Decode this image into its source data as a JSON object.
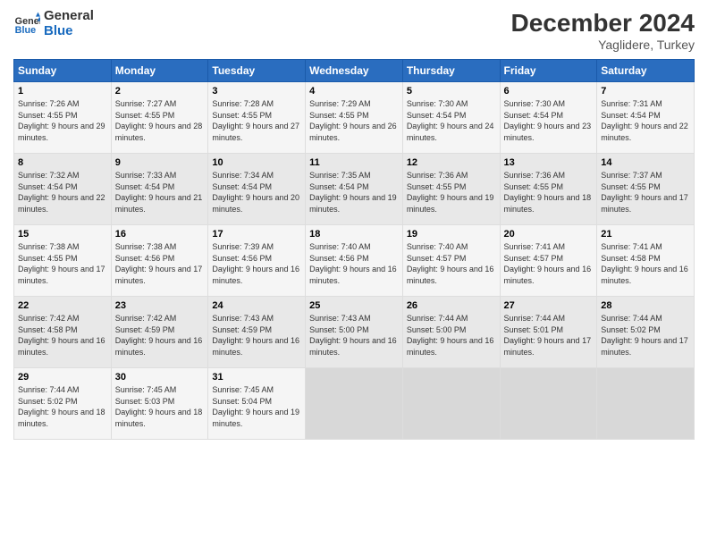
{
  "header": {
    "logo_line1": "General",
    "logo_line2": "Blue",
    "month": "December 2024",
    "location": "Yaglidere, Turkey"
  },
  "weekdays": [
    "Sunday",
    "Monday",
    "Tuesday",
    "Wednesday",
    "Thursday",
    "Friday",
    "Saturday"
  ],
  "weeks": [
    [
      {
        "day": "1",
        "sunrise": "Sunrise: 7:26 AM",
        "sunset": "Sunset: 4:55 PM",
        "daylight": "Daylight: 9 hours and 29 minutes."
      },
      {
        "day": "2",
        "sunrise": "Sunrise: 7:27 AM",
        "sunset": "Sunset: 4:55 PM",
        "daylight": "Daylight: 9 hours and 28 minutes."
      },
      {
        "day": "3",
        "sunrise": "Sunrise: 7:28 AM",
        "sunset": "Sunset: 4:55 PM",
        "daylight": "Daylight: 9 hours and 27 minutes."
      },
      {
        "day": "4",
        "sunrise": "Sunrise: 7:29 AM",
        "sunset": "Sunset: 4:55 PM",
        "daylight": "Daylight: 9 hours and 26 minutes."
      },
      {
        "day": "5",
        "sunrise": "Sunrise: 7:30 AM",
        "sunset": "Sunset: 4:54 PM",
        "daylight": "Daylight: 9 hours and 24 minutes."
      },
      {
        "day": "6",
        "sunrise": "Sunrise: 7:30 AM",
        "sunset": "Sunset: 4:54 PM",
        "daylight": "Daylight: 9 hours and 23 minutes."
      },
      {
        "day": "7",
        "sunrise": "Sunrise: 7:31 AM",
        "sunset": "Sunset: 4:54 PM",
        "daylight": "Daylight: 9 hours and 22 minutes."
      }
    ],
    [
      {
        "day": "8",
        "sunrise": "Sunrise: 7:32 AM",
        "sunset": "Sunset: 4:54 PM",
        "daylight": "Daylight: 9 hours and 22 minutes."
      },
      {
        "day": "9",
        "sunrise": "Sunrise: 7:33 AM",
        "sunset": "Sunset: 4:54 PM",
        "daylight": "Daylight: 9 hours and 21 minutes."
      },
      {
        "day": "10",
        "sunrise": "Sunrise: 7:34 AM",
        "sunset": "Sunset: 4:54 PM",
        "daylight": "Daylight: 9 hours and 20 minutes."
      },
      {
        "day": "11",
        "sunrise": "Sunrise: 7:35 AM",
        "sunset": "Sunset: 4:54 PM",
        "daylight": "Daylight: 9 hours and 19 minutes."
      },
      {
        "day": "12",
        "sunrise": "Sunrise: 7:36 AM",
        "sunset": "Sunset: 4:55 PM",
        "daylight": "Daylight: 9 hours and 19 minutes."
      },
      {
        "day": "13",
        "sunrise": "Sunrise: 7:36 AM",
        "sunset": "Sunset: 4:55 PM",
        "daylight": "Daylight: 9 hours and 18 minutes."
      },
      {
        "day": "14",
        "sunrise": "Sunrise: 7:37 AM",
        "sunset": "Sunset: 4:55 PM",
        "daylight": "Daylight: 9 hours and 17 minutes."
      }
    ],
    [
      {
        "day": "15",
        "sunrise": "Sunrise: 7:38 AM",
        "sunset": "Sunset: 4:55 PM",
        "daylight": "Daylight: 9 hours and 17 minutes."
      },
      {
        "day": "16",
        "sunrise": "Sunrise: 7:38 AM",
        "sunset": "Sunset: 4:56 PM",
        "daylight": "Daylight: 9 hours and 17 minutes."
      },
      {
        "day": "17",
        "sunrise": "Sunrise: 7:39 AM",
        "sunset": "Sunset: 4:56 PM",
        "daylight": "Daylight: 9 hours and 16 minutes."
      },
      {
        "day": "18",
        "sunrise": "Sunrise: 7:40 AM",
        "sunset": "Sunset: 4:56 PM",
        "daylight": "Daylight: 9 hours and 16 minutes."
      },
      {
        "day": "19",
        "sunrise": "Sunrise: 7:40 AM",
        "sunset": "Sunset: 4:57 PM",
        "daylight": "Daylight: 9 hours and 16 minutes."
      },
      {
        "day": "20",
        "sunrise": "Sunrise: 7:41 AM",
        "sunset": "Sunset: 4:57 PM",
        "daylight": "Daylight: 9 hours and 16 minutes."
      },
      {
        "day": "21",
        "sunrise": "Sunrise: 7:41 AM",
        "sunset": "Sunset: 4:58 PM",
        "daylight": "Daylight: 9 hours and 16 minutes."
      }
    ],
    [
      {
        "day": "22",
        "sunrise": "Sunrise: 7:42 AM",
        "sunset": "Sunset: 4:58 PM",
        "daylight": "Daylight: 9 hours and 16 minutes."
      },
      {
        "day": "23",
        "sunrise": "Sunrise: 7:42 AM",
        "sunset": "Sunset: 4:59 PM",
        "daylight": "Daylight: 9 hours and 16 minutes."
      },
      {
        "day": "24",
        "sunrise": "Sunrise: 7:43 AM",
        "sunset": "Sunset: 4:59 PM",
        "daylight": "Daylight: 9 hours and 16 minutes."
      },
      {
        "day": "25",
        "sunrise": "Sunrise: 7:43 AM",
        "sunset": "Sunset: 5:00 PM",
        "daylight": "Daylight: 9 hours and 16 minutes."
      },
      {
        "day": "26",
        "sunrise": "Sunrise: 7:44 AM",
        "sunset": "Sunset: 5:00 PM",
        "daylight": "Daylight: 9 hours and 16 minutes."
      },
      {
        "day": "27",
        "sunrise": "Sunrise: 7:44 AM",
        "sunset": "Sunset: 5:01 PM",
        "daylight": "Daylight: 9 hours and 17 minutes."
      },
      {
        "day": "28",
        "sunrise": "Sunrise: 7:44 AM",
        "sunset": "Sunset: 5:02 PM",
        "daylight": "Daylight: 9 hours and 17 minutes."
      }
    ],
    [
      {
        "day": "29",
        "sunrise": "Sunrise: 7:44 AM",
        "sunset": "Sunset: 5:02 PM",
        "daylight": "Daylight: 9 hours and 18 minutes."
      },
      {
        "day": "30",
        "sunrise": "Sunrise: 7:45 AM",
        "sunset": "Sunset: 5:03 PM",
        "daylight": "Daylight: 9 hours and 18 minutes."
      },
      {
        "day": "31",
        "sunrise": "Sunrise: 7:45 AM",
        "sunset": "Sunset: 5:04 PM",
        "daylight": "Daylight: 9 hours and 19 minutes."
      },
      null,
      null,
      null,
      null
    ]
  ]
}
